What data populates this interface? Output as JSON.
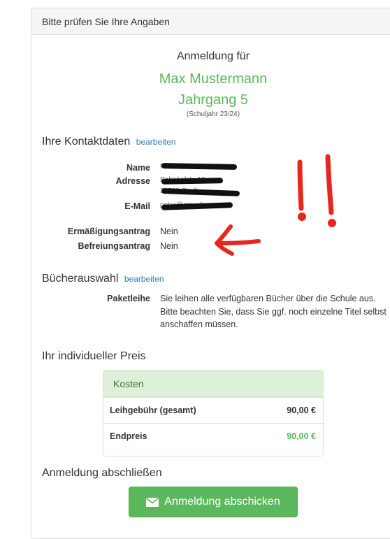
{
  "panel": {
    "heading": "Bitte prüfen Sie Ihre Angaben"
  },
  "registration": {
    "title": "Anmeldung für",
    "student_name": "Max Mustermann",
    "grade": "Jahrgang 5",
    "school_year": "(Schuljahr 23/24)"
  },
  "contact": {
    "title": "Ihre Kontaktdaten",
    "edit_link": "bearbeiten",
    "name_label": "Name",
    "name_value": "Peter Mustermann",
    "address_label": "Adresse",
    "address_value": "Bahnhofstr. 12",
    "address_value2": "31582 Stadt",
    "email_label": "E-Mail",
    "email_value": "peter@gmx.de",
    "reduction_label": "Ermäßigungsantrag",
    "reduction_value": "Nein",
    "exemption_label": "Befreiungsantrag",
    "exemption_value": "Nein"
  },
  "books": {
    "title": "Bücherauswahl",
    "edit_link": "bearbeiten",
    "package_label": "Paketleihe",
    "package_text": "Sie leihen alle verfügbaren Bücher über die Schule aus. Bitte beachten Sie, dass Sie ggf. noch einzelne Titel selbst anschaffen müssen."
  },
  "price": {
    "title": "Ihr individueller Preis",
    "table_header": "Kosten",
    "rows": [
      {
        "label": "Leihgebühr (gesamt)",
        "value": "90,00 €"
      },
      {
        "label": "Endpreis",
        "value": "90,00 €"
      }
    ]
  },
  "finish": {
    "title": "Anmeldung abschließen",
    "button_label": "Anmeldung abschicken"
  },
  "colors": {
    "accent_green": "#5cb85c",
    "link_blue": "#337ab7",
    "annotation_red": "#e8261c"
  },
  "icons": {
    "send_button": "envelope-icon"
  }
}
